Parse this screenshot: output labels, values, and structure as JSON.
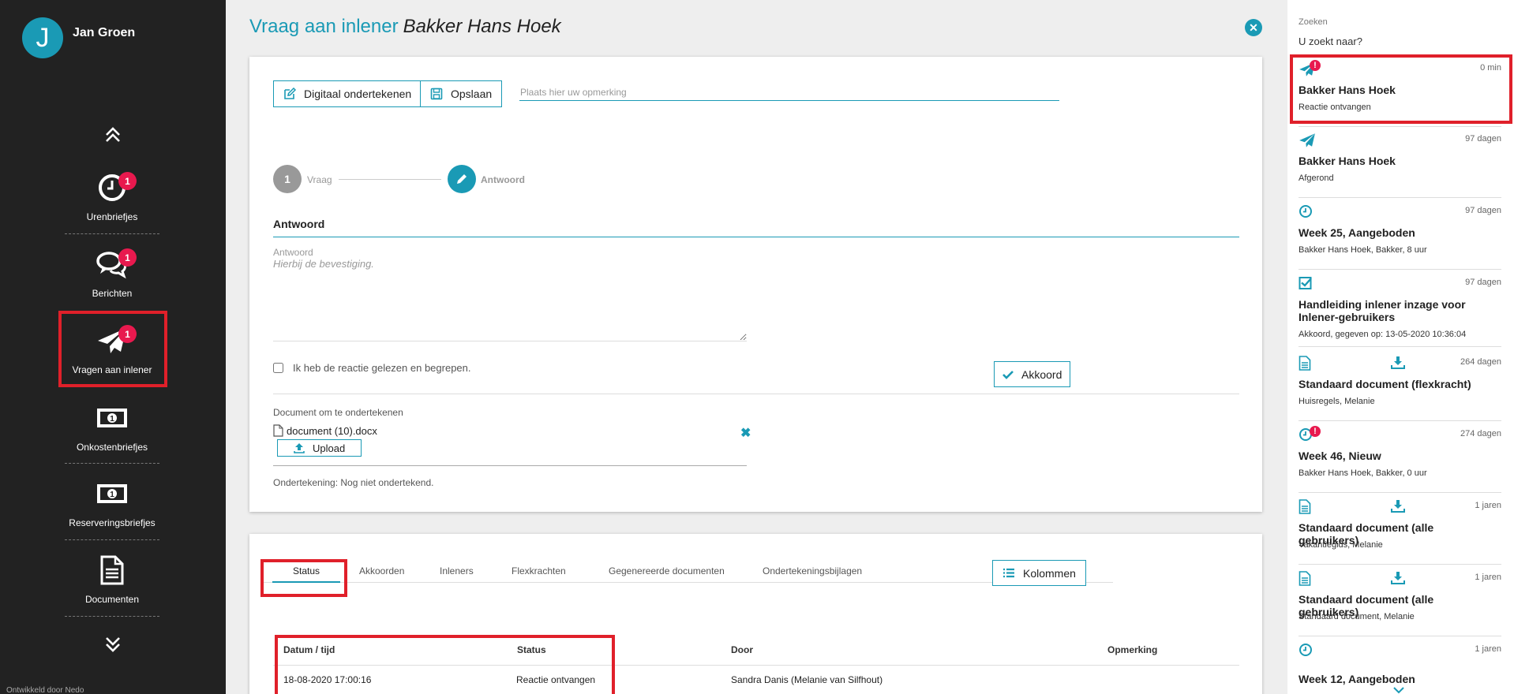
{
  "user": {
    "initial": "J",
    "name": "Jan Groen"
  },
  "nav": {
    "items": [
      {
        "label": "Urenbriefjes",
        "badge": "1"
      },
      {
        "label": "Berichten",
        "badge": "1"
      },
      {
        "label": "Vragen aan inlener",
        "badge": "1"
      },
      {
        "label": "Onkostenbriefjes"
      },
      {
        "label": "Reserveringsbriefjes"
      },
      {
        "label": "Documenten"
      }
    ],
    "footer": "Ontwikkeld door Nedo"
  },
  "header": {
    "title": "Vraag aan inlener",
    "subject": "Bakker Hans Hoek",
    "close": "✕"
  },
  "toolbar": {
    "sign_label": "Digitaal ondertekenen",
    "save_label": "Opslaan",
    "remark_placeholder": "Plaats hier uw opmerking"
  },
  "steps": [
    {
      "number": "1",
      "label": "Vraag"
    },
    {
      "label": "Antwoord"
    }
  ],
  "answer": {
    "heading": "Antwoord",
    "field_label": "Antwoord",
    "value": "Hierbij de bevestiging.",
    "checkbox_label": "Ik heb de reactie gelezen en begrepen.",
    "agree_label": "Akkoord"
  },
  "document": {
    "label": "Document om te ondertekenen",
    "filename": "document (10).docx",
    "upload_label": "Upload",
    "remove": "✖",
    "signing_status": "Ondertekening:  Nog niet ondertekend."
  },
  "tabs": [
    "Status",
    "Akkoorden",
    "Inleners",
    "Flexkrachten",
    "Gegenereerde documenten",
    "Ondertekeningsbijlagen"
  ],
  "columns_label": "Kolommen",
  "table": {
    "headers": [
      "Datum / tijd",
      "Status",
      "Door",
      "Opmerking"
    ],
    "rows": [
      [
        "18-08-2020 17:00:16",
        "Reactie ontvangen",
        "Sandra Danis (Melanie van Silfhout)",
        ""
      ]
    ]
  },
  "search": {
    "label": "Zoeken",
    "placeholder": "U zoekt naar?"
  },
  "feed": [
    {
      "icon": "paper-plane-icon",
      "alert": "!",
      "time": "0 min",
      "title": "Bakker Hans Hoek",
      "subtitle": "Reactie ontvangen"
    },
    {
      "icon": "paper-plane-icon",
      "time": "97 dagen",
      "title": "Bakker Hans Hoek",
      "subtitle": "Afgerond"
    },
    {
      "icon": "clock-icon",
      "time": "97 dagen",
      "title": "Week 25, Aangeboden",
      "subtitle": "Bakker Hans Hoek, Bakker, 8 uur"
    },
    {
      "icon": "checkbox-icon",
      "time": "97 dagen",
      "title": "Handleiding inlener inzage voor Inlener-gebruikers",
      "subtitle": "Akkoord, gegeven op: 13-05-2020 10:36:04"
    },
    {
      "icon": "document-icon",
      "mid": "download-icon",
      "time": "264 dagen",
      "title": "Standaard document (flexkracht)",
      "subtitle": "Huisregels, Melanie"
    },
    {
      "icon": "clock-icon",
      "alert": "!",
      "time": "274 dagen",
      "title": "Week 46, Nieuw",
      "subtitle": "Bakker Hans Hoek, Bakker, 0 uur"
    },
    {
      "icon": "document-icon",
      "mid": "download-icon",
      "time": "1 jaren",
      "title": "Standaard document (alle gebruikers)",
      "subtitle": "Vakantiegids, Melanie"
    },
    {
      "icon": "document-icon",
      "mid": "download-icon",
      "time": "1 jaren",
      "title": "Standaard document (alle gebruikers)",
      "subtitle": "Standaard document, Melanie"
    },
    {
      "icon": "clock-icon",
      "time": "1 jaren",
      "title": "Week 12, Aangeboden",
      "subtitle": ""
    }
  ],
  "colors": {
    "accent": "#1a9ab5",
    "badge": "#e8194e",
    "highlight": "#e0202a",
    "sidebar": "#222222"
  }
}
